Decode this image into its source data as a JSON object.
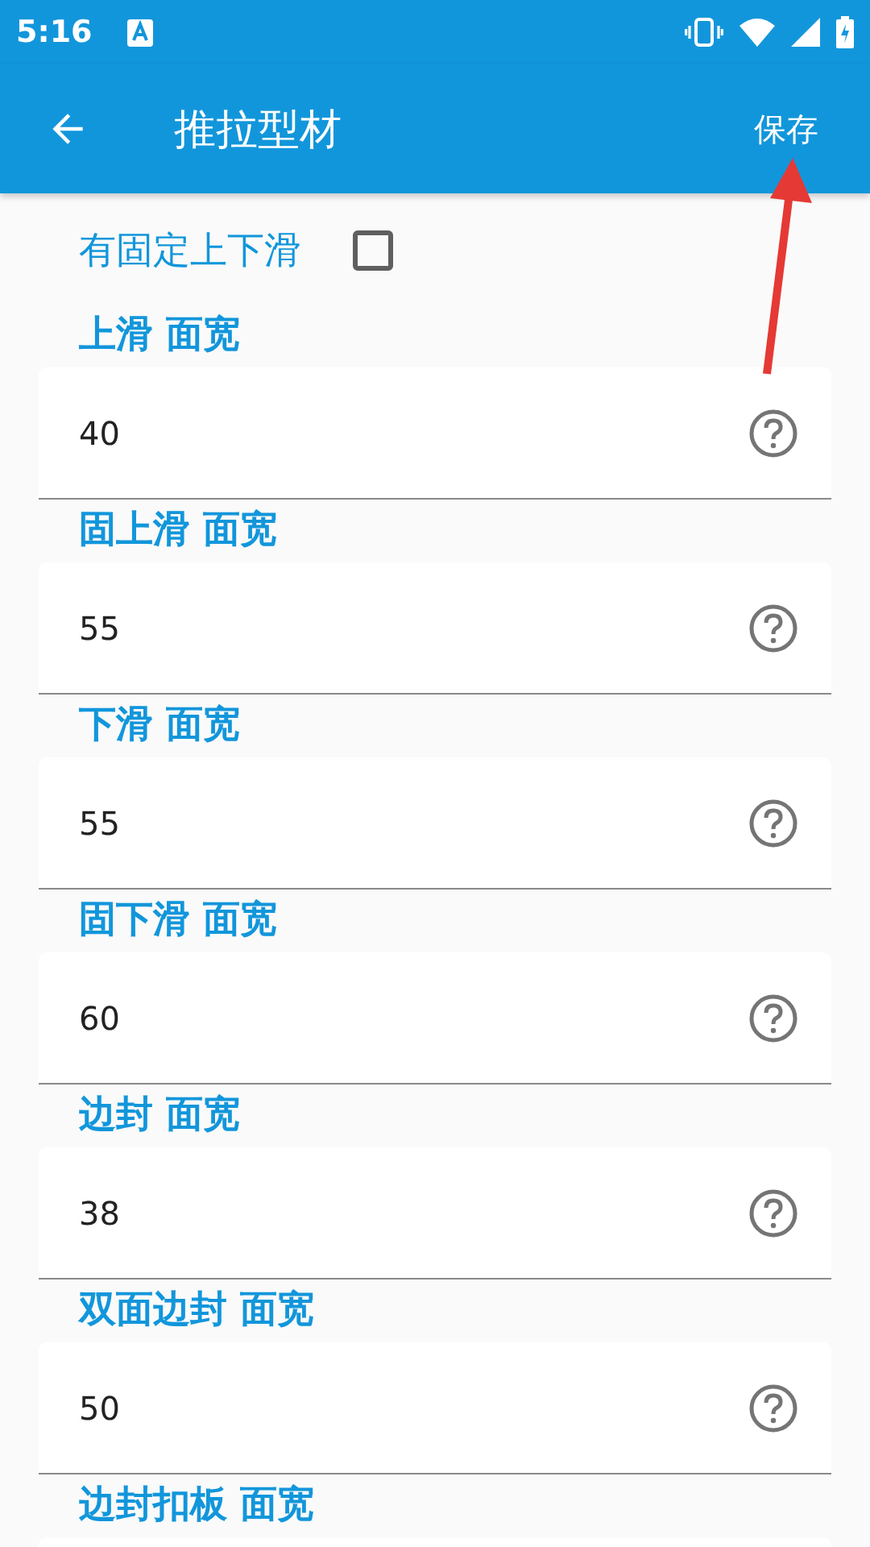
{
  "status_bar": {
    "time": "5:16"
  },
  "app_bar": {
    "title": "推拉型材",
    "action": "保存"
  },
  "fixed_option": {
    "label": "有固定上下滑",
    "checked": false
  },
  "fields": [
    {
      "label": "上滑 面宽",
      "value": "40"
    },
    {
      "label": "固上滑 面宽",
      "value": "55"
    },
    {
      "label": "下滑 面宽",
      "value": "55"
    },
    {
      "label": "固下滑 面宽",
      "value": "60"
    },
    {
      "label": "边封 面宽",
      "value": "38"
    },
    {
      "label": "双面边封 面宽",
      "value": "50"
    },
    {
      "label": "边封扣板 面宽"
    }
  ]
}
